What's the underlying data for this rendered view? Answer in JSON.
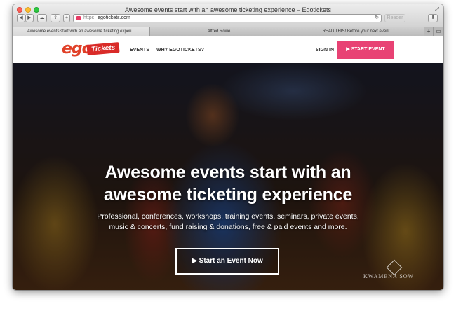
{
  "browser": {
    "window_title": "Awesome events start with an awesome ticketing experience – Egotickets",
    "url_scheme": "https",
    "url_host": "egotickets.com",
    "reader_label": "Reader",
    "tabs": [
      {
        "label": "Awesome events start with an awesome ticketing experi..."
      },
      {
        "label": "Alfred Rowe"
      },
      {
        "label": "READ THIS! Before your next event"
      }
    ]
  },
  "site": {
    "logo_ego": "ego",
    "logo_tickets": "Tickets",
    "nav_events": "EVENTS",
    "nav_why": "WHY EGOTICKETS?",
    "sign_in": "SIGN IN",
    "start_event": "▶ START EVENT"
  },
  "hero": {
    "title_line1": "Awesome events start with an",
    "title_line2": "awesome ticketing experience",
    "subtitle_line1": "Professional, conferences, workshops, training events, seminars, private events,",
    "subtitle_line2": "music & concerts, fund raising & donations, free & paid events and more.",
    "cta": "▶ Start an Event Now",
    "watermark": "KWAMENA SOW"
  },
  "colors": {
    "accent": "#e84274",
    "logo_red": "#e04027"
  }
}
